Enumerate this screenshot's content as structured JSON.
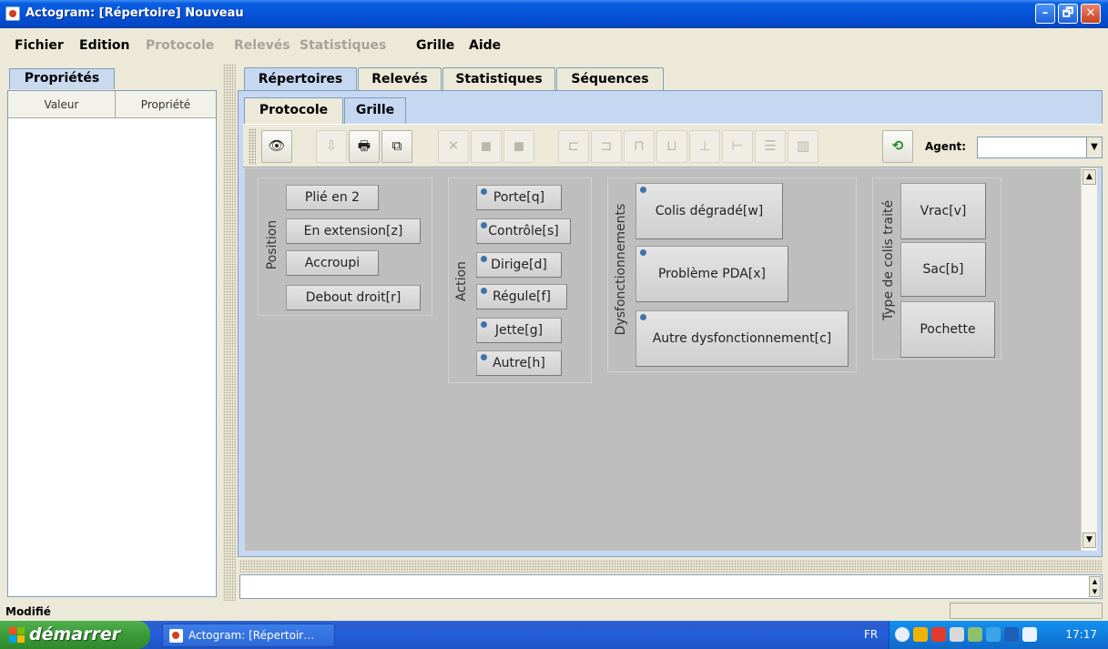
{
  "window": {
    "title": "Actogram: [Répertoire] Nouveau",
    "minimize": "–",
    "maximize": "🗗",
    "close": "✕"
  },
  "menu": [
    {
      "label": "Fichier",
      "enabled": true
    },
    {
      "label": "Edition",
      "enabled": true
    },
    {
      "label": "Protocole",
      "enabled": false
    },
    {
      "label": "Relevés",
      "enabled": false
    },
    {
      "label": "Statistiques",
      "enabled": false
    },
    {
      "label": "Grille",
      "enabled": true
    },
    {
      "label": "Aide",
      "enabled": true
    }
  ],
  "properties_panel": {
    "tab": "Propriétés",
    "columns": [
      "Valeur",
      "Propriété"
    ]
  },
  "outer_tabs": [
    "Répertoires",
    "Relevés",
    "Statistiques",
    "Séquences"
  ],
  "inner_tabs": [
    "Protocole",
    "Grille"
  ],
  "toolbar": {
    "buttons": [
      {
        "icon": "eye-icon",
        "glyph": "👁"
      },
      {
        "icon": "import-icon",
        "glyph": "⇩"
      },
      {
        "icon": "print-icon",
        "glyph": "🖶"
      },
      {
        "icon": "copy-icon",
        "glyph": "⧉"
      },
      {
        "icon": "delete-icon",
        "glyph": "✕"
      },
      {
        "icon": "bring-front-icon",
        "glyph": "◼"
      },
      {
        "icon": "send-back-icon",
        "glyph": "◼"
      },
      {
        "icon": "align-left-icon",
        "glyph": "⊏"
      },
      {
        "icon": "align-right-icon",
        "glyph": "⊐"
      },
      {
        "icon": "align-top-icon",
        "glyph": "⊓"
      },
      {
        "icon": "align-bottom-icon",
        "glyph": "⊔"
      },
      {
        "icon": "center-vertical-icon",
        "glyph": "⊥"
      },
      {
        "icon": "center-horizontal-icon",
        "glyph": "⊢"
      },
      {
        "icon": "distribute-vertical-icon",
        "glyph": "☰"
      },
      {
        "icon": "distribute-horizontal-icon",
        "glyph": "▥"
      },
      {
        "icon": "refresh-icon",
        "glyph": "⟲"
      }
    ],
    "agent_label": "Agent:",
    "agent_value": ""
  },
  "grid": {
    "groups": [
      {
        "label": "Position",
        "buttons": [
          "Plié en 2",
          "En extension[z]",
          "Accroupi",
          "Debout droit[r]"
        ]
      },
      {
        "label": "Action",
        "buttons": [
          "Porte[q]",
          "Contrôle[s]",
          "Dirige[d]",
          "Régule[f]",
          "Jette[g]",
          "Autre[h]"
        ]
      },
      {
        "label": "Dysfonctionnements",
        "buttons": [
          "Colis dégradé[w]",
          "Problème PDA[x]",
          "Autre dysfonctionnement[c]"
        ]
      },
      {
        "label": "Type de colis traité",
        "buttons": [
          "Vrac[v]",
          "Sac[b]",
          "Pochette"
        ]
      }
    ]
  },
  "status": {
    "text": "Modifié"
  },
  "taskbar": {
    "start_label": "démarrer",
    "task": "Actogram: [Répertoir…",
    "lang": "FR",
    "clock": "17:17"
  }
}
